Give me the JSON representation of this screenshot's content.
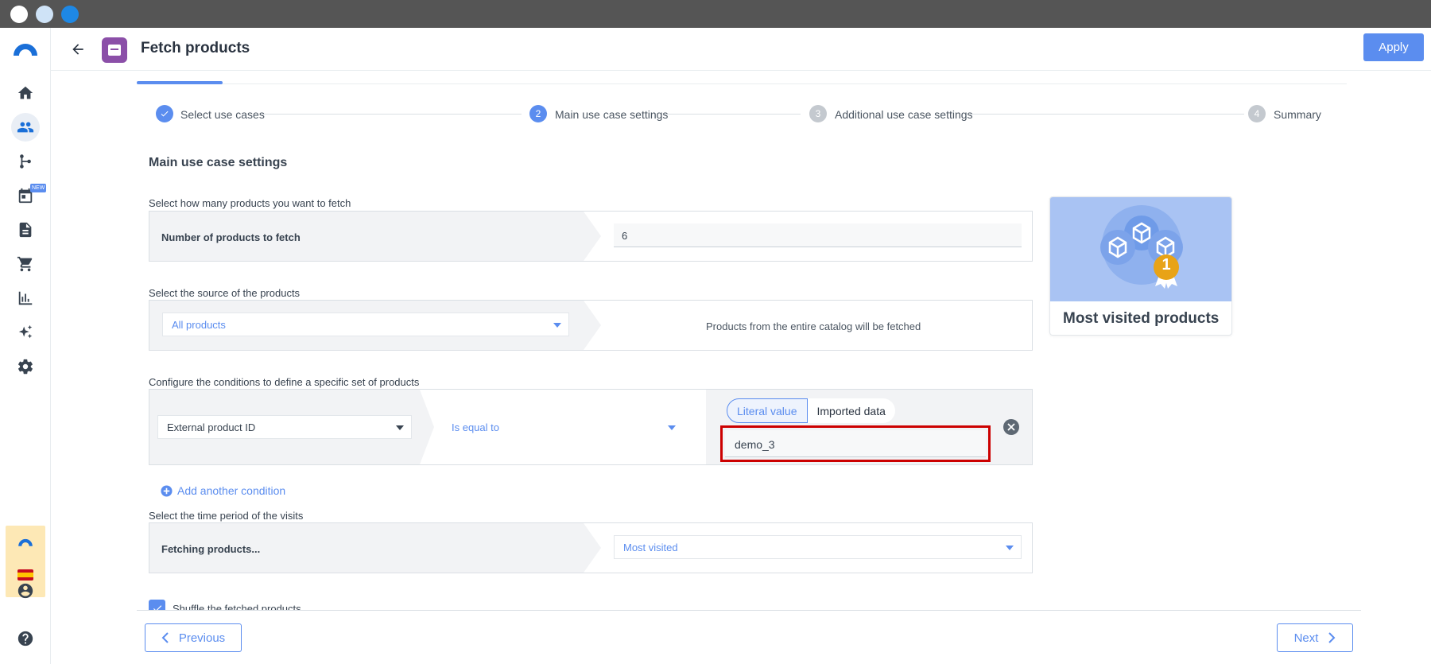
{
  "colors": {
    "accent": "#5b8def",
    "title_bar": "#555555",
    "highlight": "#cc0000",
    "app_icon": "#8b4fa8"
  },
  "window": {
    "traffic_lights": [
      "#ffffff",
      "#cfe3f7",
      "#1e88e5"
    ]
  },
  "rail": {
    "items": [
      {
        "icon": "home-icon"
      },
      {
        "icon": "people-icon",
        "active": true
      },
      {
        "icon": "branch-icon"
      },
      {
        "icon": "calendar-icon",
        "badge": "NEW"
      },
      {
        "icon": "document-icon"
      },
      {
        "icon": "cart-icon"
      },
      {
        "icon": "bar-chart-icon"
      },
      {
        "icon": "sparkle-icon"
      },
      {
        "icon": "gear-icon"
      }
    ],
    "bottom": [
      {
        "icon": "account-icon"
      },
      {
        "icon": "help-icon"
      }
    ]
  },
  "header": {
    "title": "Fetch products",
    "apply_label": "Apply"
  },
  "steps": [
    {
      "number": "",
      "label": "Select use cases",
      "state": "done"
    },
    {
      "number": "2",
      "label": "Main use case settings",
      "state": "active"
    },
    {
      "number": "3",
      "label": "Additional use case settings",
      "state": "todo"
    },
    {
      "number": "4",
      "label": "Summary",
      "state": "todo"
    }
  ],
  "main": {
    "title": "Main use case settings",
    "count_section": {
      "label": "Select how many products you want to fetch",
      "field_label": "Number of products to fetch",
      "value": "6"
    },
    "source_section": {
      "label": "Select the source of the products",
      "selected": "All products",
      "description": "Products from the entire catalog will be fetched"
    },
    "conditions_section": {
      "label": "Configure the conditions to define a specific set of products",
      "attribute": "External product ID",
      "operator": "Is equal to",
      "toggle_literal": "Literal value",
      "toggle_imported": "Imported data",
      "value": "demo_3",
      "add_condition_label": "Add another condition"
    },
    "time_section": {
      "label": "Select the time period of the visits",
      "field_label": "Fetching products...",
      "selected": "Most visited"
    },
    "shuffle_label": "Shuffle the fetched products"
  },
  "card": {
    "title": "Most visited products",
    "badge_number": "1"
  },
  "footer": {
    "previous_label": "Previous",
    "next_label": "Next"
  }
}
